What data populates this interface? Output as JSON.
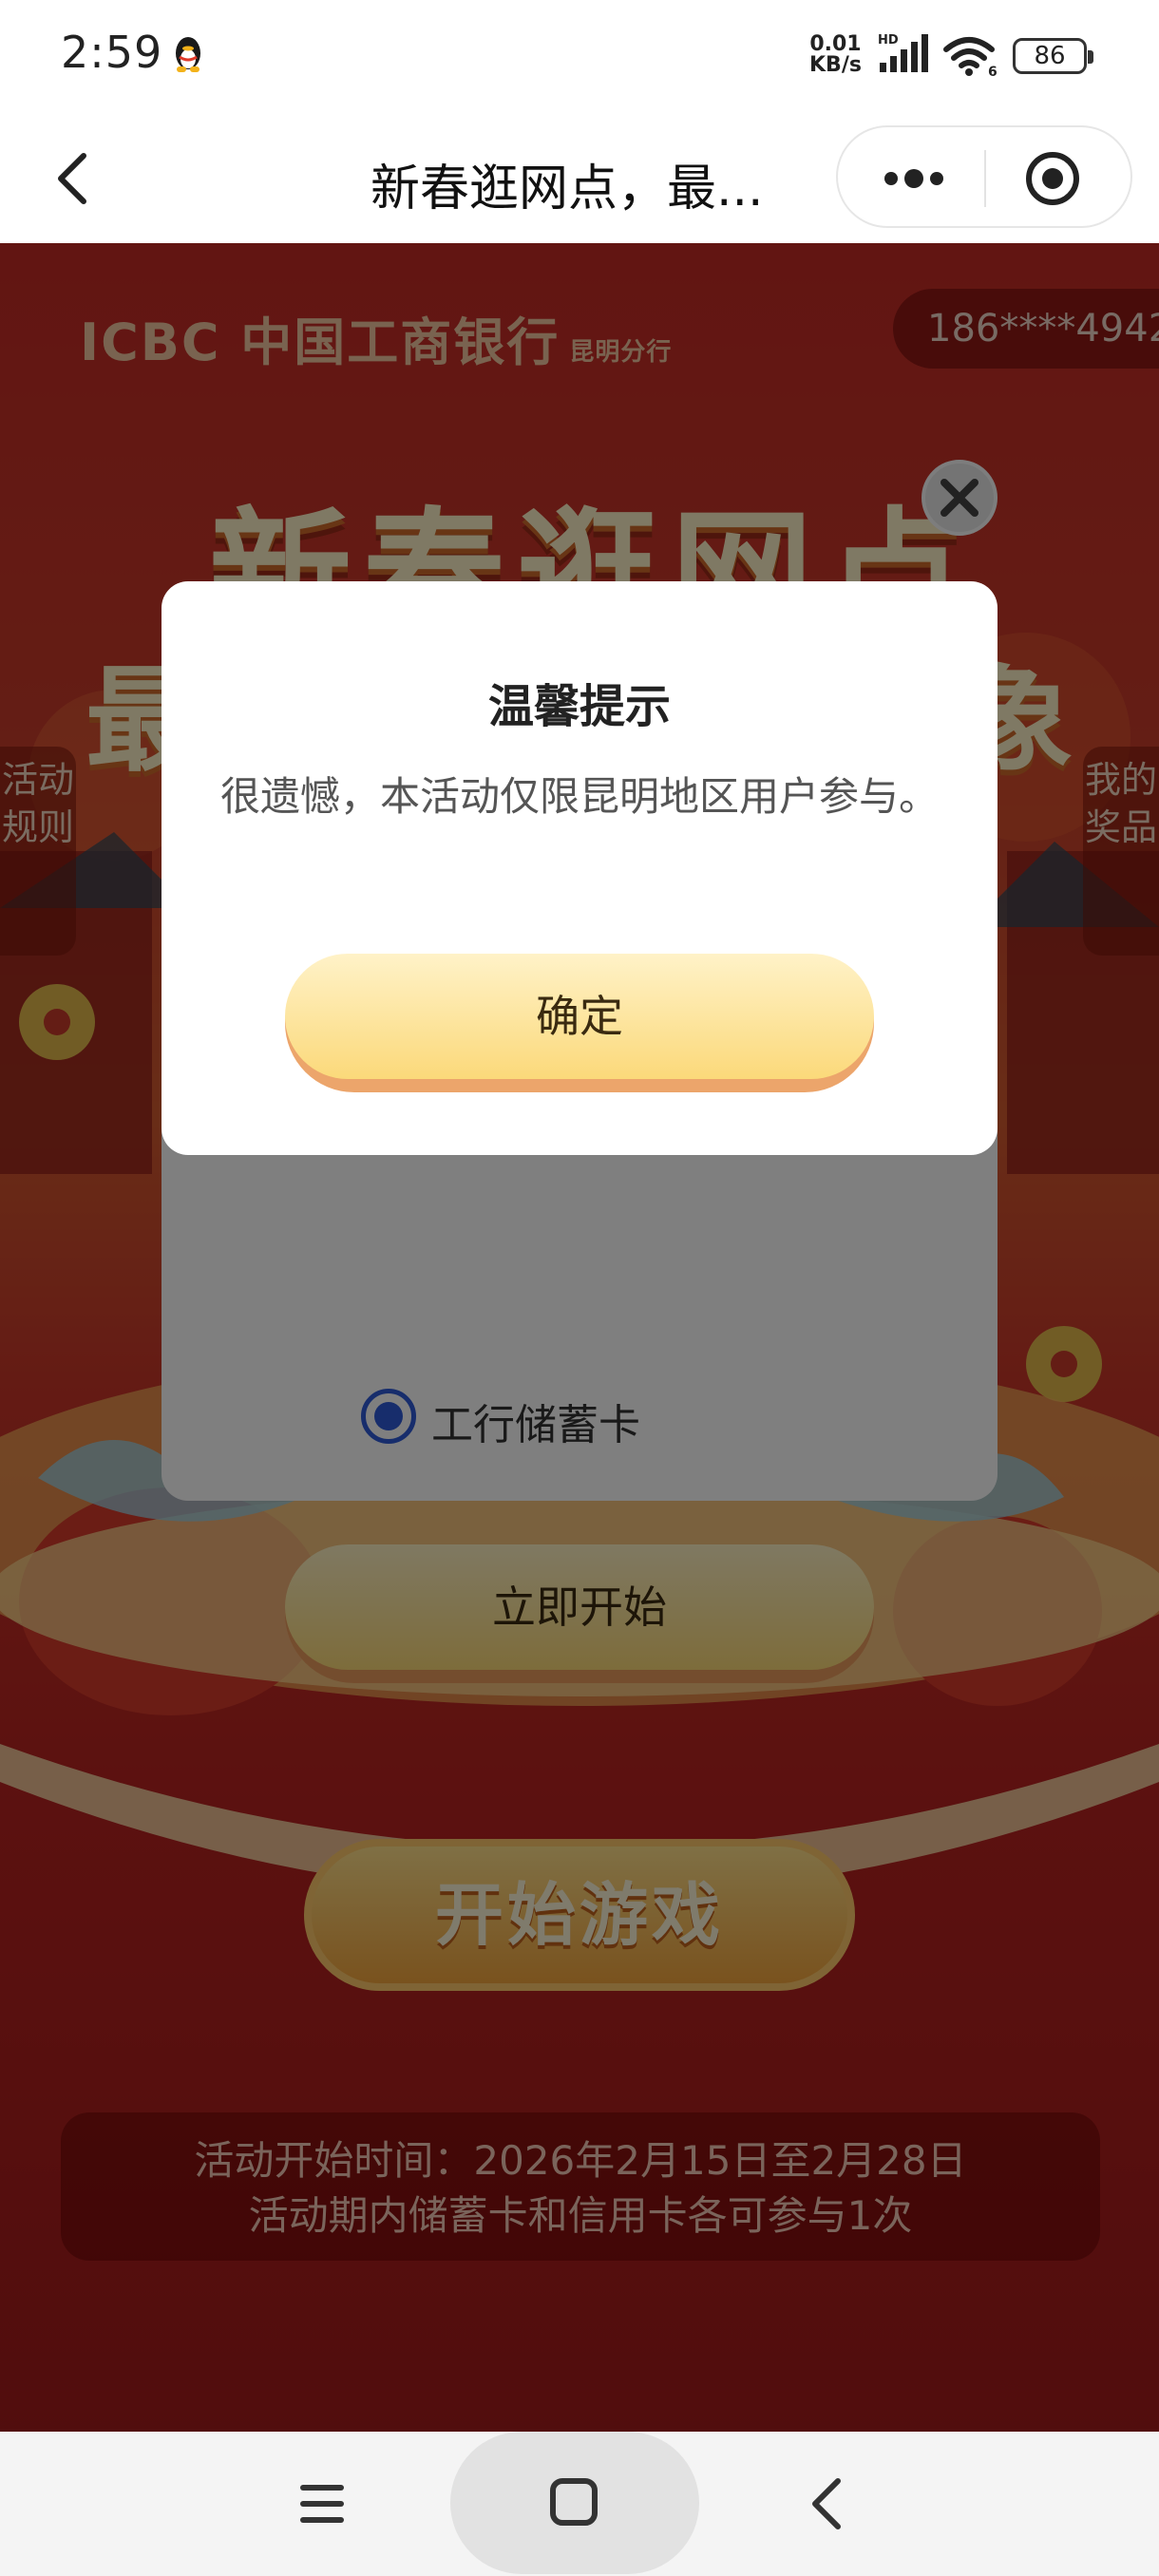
{
  "status_bar": {
    "time": "2:59",
    "net_speed_value": "0.01",
    "net_speed_unit": "KB/s",
    "hd_label": "HD",
    "battery": "86"
  },
  "nav": {
    "title": "新春逛网点，最...",
    "more_label": "more",
    "icons": [
      "back-icon",
      "more-dots-icon",
      "target-icon"
    ]
  },
  "background": {
    "bank_name": "ICBC 中国工商银行",
    "branch": "昆明分行",
    "phone": "186****4942",
    "hero_line1": "新春逛网点",
    "hero_line2_left": "最",
    "hero_line2_right": "象",
    "rules_tab": "活动规则",
    "prizes_tab": "我的奖品",
    "card_option": "工行储蓄卡",
    "start_now": "立即开始",
    "start_game": "开始游戏",
    "event_time": "活动开始时间：2026年2月15日至2月28日",
    "event_rule": "活动期内储蓄卡和信用卡各可参与1次"
  },
  "dialog": {
    "title": "温馨提示",
    "message": "很遗憾，本活动仅限昆明地区用户参与。",
    "confirm": "确定"
  },
  "colors": {
    "accent_blue": "#2f5bd8",
    "button_gold": "#fbd976",
    "page_red": "#c52a25"
  }
}
